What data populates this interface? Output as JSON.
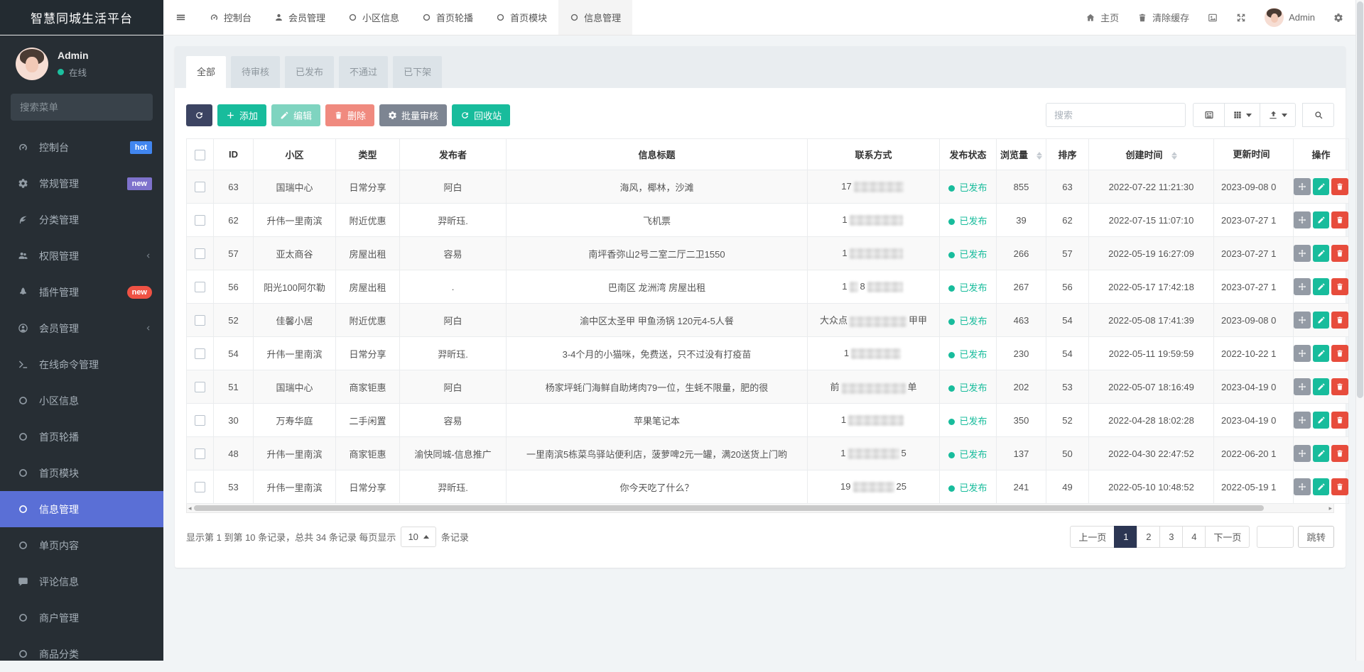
{
  "brand": "智慧同城生活平台",
  "colors": {
    "accent_green": "#18bc9c",
    "danger_red": "#e74c3c",
    "active_menu_blue": "#5a6fd6",
    "badge_hot_blue": "#4186f0",
    "badge_new_purple": "#7e72cc",
    "badge_new_red": "#ef5244",
    "dark_navy": "#3c4462",
    "online_green": "#1cc09f"
  },
  "topnav": {
    "menu": [
      {
        "label": "控制台",
        "icon": "dashboard-icon",
        "active": false
      },
      {
        "label": "会员管理",
        "icon": "user-icon",
        "active": false
      },
      {
        "label": "小区信息",
        "icon": "circle-icon",
        "active": false
      },
      {
        "label": "首页轮播",
        "icon": "circle-icon",
        "active": false
      },
      {
        "label": "首页模块",
        "icon": "circle-icon",
        "active": false
      },
      {
        "label": "信息管理",
        "icon": "circle-icon",
        "active": true
      }
    ],
    "right": [
      {
        "name": "home-link",
        "icon": "home-icon",
        "label": "主页"
      },
      {
        "name": "clear-cache-link",
        "icon": "trash-icon",
        "label": "清除缓存"
      },
      {
        "name": "image-button",
        "icon": "image-icon",
        "label": ""
      },
      {
        "name": "fullscreen-button",
        "icon": "expand-icon",
        "label": ""
      },
      {
        "name": "user-menu",
        "avatar": true,
        "label": "Admin"
      },
      {
        "name": "settings-button",
        "icon": "gears-icon",
        "label": ""
      }
    ]
  },
  "sidebar": {
    "user": {
      "name": "Admin",
      "status": "在线"
    },
    "search_placeholder": "搜索菜单",
    "items": [
      {
        "label": "控制台",
        "icon": "dashboard-icon",
        "badge": "hot",
        "badge_style": "blue"
      },
      {
        "label": "常规管理",
        "icon": "gears-icon",
        "badge": "new",
        "badge_style": "purple"
      },
      {
        "label": "分类管理",
        "icon": "leaf-icon"
      },
      {
        "label": "权限管理",
        "icon": "users-icon",
        "arrow": true
      },
      {
        "label": "插件管理",
        "icon": "rocket-icon",
        "badge": "new",
        "badge_style": "red-pill"
      },
      {
        "label": "会员管理",
        "icon": "user-circle-icon",
        "arrow": true
      },
      {
        "label": "在线命令管理",
        "icon": "terminal-icon"
      },
      {
        "label": "小区信息",
        "icon": "circle-icon"
      },
      {
        "label": "首页轮播",
        "icon": "circle-icon"
      },
      {
        "label": "首页模块",
        "icon": "circle-icon"
      },
      {
        "label": "信息管理",
        "icon": "circle-icon",
        "active": true
      },
      {
        "label": "单页内容",
        "icon": "circle-icon"
      },
      {
        "label": "评论信息",
        "icon": "comment-icon"
      },
      {
        "label": "商户管理",
        "icon": "circle-icon"
      },
      {
        "label": "商品分类",
        "icon": "circle-icon"
      }
    ]
  },
  "content": {
    "tabs": [
      {
        "label": "全部",
        "active": true
      },
      {
        "label": "待审核",
        "active": false
      },
      {
        "label": "已发布",
        "active": false
      },
      {
        "label": "不通过",
        "active": false
      },
      {
        "label": "已下架",
        "active": false
      }
    ],
    "toolbar": {
      "buttons": [
        {
          "name": "refresh-button",
          "label": "",
          "icon": "refresh-icon",
          "style": "dark"
        },
        {
          "name": "add-button",
          "label": "添加",
          "icon": "plus-icon",
          "style": "green"
        },
        {
          "name": "edit-button",
          "label": "编辑",
          "icon": "pencil-icon",
          "style": "green-light"
        },
        {
          "name": "delete-button",
          "label": "删除",
          "icon": "trash-icon",
          "style": "red-light"
        },
        {
          "name": "batch-audit-button",
          "label": "批量审核",
          "icon": "gear-icon",
          "style": "gray"
        },
        {
          "name": "recycle-button",
          "label": "回收站",
          "icon": "recycle-icon",
          "style": "green"
        }
      ],
      "search_placeholder": "搜索",
      "view_buttons": [
        {
          "name": "detail-view-button",
          "icon": "list-icon",
          "caret": false
        },
        {
          "name": "columns-button",
          "icon": "columns-icon",
          "caret": true
        },
        {
          "name": "export-button",
          "icon": "export-icon",
          "caret": true
        }
      ]
    },
    "table": {
      "headers": [
        {
          "label": "ID"
        },
        {
          "label": "小区"
        },
        {
          "label": "类型"
        },
        {
          "label": "发布者"
        },
        {
          "label": "信息标题"
        },
        {
          "label": "联系方式"
        },
        {
          "label": "发布状态"
        },
        {
          "label": "浏览量",
          "sortable": true
        },
        {
          "label": "排序"
        },
        {
          "label": "创建时间",
          "sortable": true
        },
        {
          "label": "更新时间",
          "clipped": true
        },
        {
          "label": "操作"
        }
      ],
      "rows": [
        {
          "id": "63",
          "community": "国瑞中心",
          "type": "日常分享",
          "publisher": "阿白",
          "title": "海风，椰林，沙滩",
          "contact": [
            {
              "t": "17"
            },
            {
              "b": 70
            }
          ],
          "status": "已发布",
          "views": "855",
          "sort": "63",
          "created": "2022-07-22 11:21:30",
          "updated": "2023-09-08 0"
        },
        {
          "id": "62",
          "community": "升伟一里南滨",
          "type": "附近优惠",
          "publisher": "羿昕珏.",
          "title": "飞机票",
          "contact": [
            {
              "t": "1"
            },
            {
              "b": 75
            }
          ],
          "status": "已发布",
          "views": "39",
          "sort": "62",
          "created": "2022-07-15 11:07:10",
          "updated": "2023-07-27 1"
        },
        {
          "id": "57",
          "community": "亚太商谷",
          "type": "房屋出租",
          "publisher": "容易",
          "title": "南坪香弥山2号二室二厅二卫1550",
          "contact": [
            {
              "t": "1"
            },
            {
              "b": 75
            }
          ],
          "status": "已发布",
          "views": "266",
          "sort": "57",
          "created": "2022-05-19 16:27:09",
          "updated": "2023-07-27 1"
        },
        {
          "id": "56",
          "community": "阳光100阿尔勒",
          "type": "房屋出租",
          "publisher": ".",
          "title": "巴南区 龙洲湾 房屋出租",
          "contact": [
            {
              "t": "1"
            },
            {
              "b": 12
            },
            {
              "t": "8"
            },
            {
              "b": 50
            }
          ],
          "status": "已发布",
          "views": "267",
          "sort": "56",
          "created": "2022-05-17 17:42:18",
          "updated": "2023-07-27 1"
        },
        {
          "id": "52",
          "community": "佳馨小居",
          "type": "附近优惠",
          "publisher": "阿白",
          "title": "渝中区太圣甲 甲鱼汤锅 120元4-5人餐",
          "contact": [
            {
              "t": "大众点"
            },
            {
              "b": 80
            },
            {
              "t": "甲甲"
            }
          ],
          "status": "已发布",
          "views": "463",
          "sort": "54",
          "created": "2022-05-08 17:41:39",
          "updated": "2023-09-08 0"
        },
        {
          "id": "54",
          "community": "升伟一里南滨",
          "type": "日常分享",
          "publisher": "羿昕珏.",
          "title": "3-4个月的小猫咪，免费送，只不过没有打疫苗",
          "contact": [
            {
              "t": "1"
            },
            {
              "b": 70
            }
          ],
          "status": "已发布",
          "views": "230",
          "sort": "54",
          "created": "2022-05-11 19:59:59",
          "updated": "2022-10-22 1"
        },
        {
          "id": "51",
          "community": "国瑞中心",
          "type": "商家钜惠",
          "publisher": "阿白",
          "title": "杨家坪蚝门海鲜自助烤肉79一位，生蚝不限量，肥的很",
          "contact": [
            {
              "t": "前"
            },
            {
              "b": 90
            },
            {
              "t": "单"
            }
          ],
          "status": "已发布",
          "views": "202",
          "sort": "53",
          "created": "2022-05-07 18:16:49",
          "updated": "2023-04-19 0"
        },
        {
          "id": "30",
          "community": "万寿华庭",
          "type": "二手闲置",
          "publisher": "容易",
          "title": "苹果笔记本",
          "contact": [
            {
              "t": "1"
            },
            {
              "b": 78
            }
          ],
          "status": "已发布",
          "views": "350",
          "sort": "52",
          "created": "2022-04-28 18:02:28",
          "updated": "2023-04-19 0"
        },
        {
          "id": "48",
          "community": "升伟一里南滨",
          "type": "商家钜惠",
          "publisher": "渝快同城-信息推广",
          "title": "一里南滨5栋菜鸟驿站便利店，菠萝啤2元一罐，满20送货上门哟",
          "contact": [
            {
              "t": "1"
            },
            {
              "b": 72
            },
            {
              "t": "5"
            }
          ],
          "status": "已发布",
          "views": "137",
          "sort": "50",
          "created": "2022-04-30 22:47:52",
          "updated": "2022-06-20 1"
        },
        {
          "id": "53",
          "community": "升伟一里南滨",
          "type": "日常分享",
          "publisher": "羿昕珏.",
          "title": "你今天吃了什么？",
          "contact": [
            {
              "t": "19"
            },
            {
              "b": 58
            },
            {
              "t": "25"
            }
          ],
          "status": "已发布",
          "views": "241",
          "sort": "49",
          "created": "2022-05-10 10:48:52",
          "updated": "2022-05-19 1"
        }
      ]
    },
    "footer": {
      "info_prefix": "显示第 1 到第 10 条记录，总共 34 条记录 每页显示",
      "page_size": "10",
      "info_suffix": "条记录",
      "pagination": {
        "prev": "上一页",
        "pages": [
          "1",
          "2",
          "3",
          "4"
        ],
        "active_page": "1",
        "next": "下一页",
        "jump_label": "跳转"
      }
    }
  }
}
